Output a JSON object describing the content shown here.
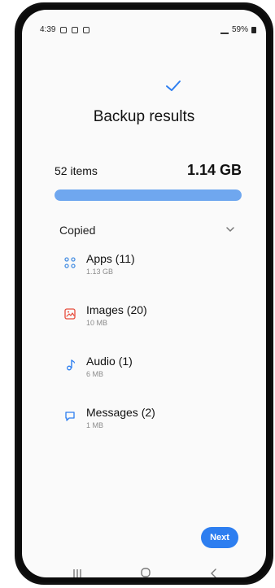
{
  "status_bar": {
    "time": "4:39",
    "right_text": "59%"
  },
  "header": {
    "title": "Backup results"
  },
  "summary": {
    "items_label": "52 items",
    "size_label": "1.14 GB",
    "progress_percent": 100
  },
  "section": {
    "label": "Copied"
  },
  "list": [
    {
      "title": "Apps (11)",
      "subtitle": "1.13 GB",
      "icon": "apps-icon"
    },
    {
      "title": "Images (20)",
      "subtitle": "10 MB",
      "icon": "image-icon"
    },
    {
      "title": "Audio (1)",
      "subtitle": "6 MB",
      "icon": "audio-icon"
    },
    {
      "title": "Messages (2)",
      "subtitle": "1 MB",
      "icon": "message-icon"
    }
  ],
  "buttons": {
    "next": "Next"
  },
  "colors": {
    "accent": "#2d7ef0",
    "progress": "#6fa7ef",
    "apps_icon": "#4a90e2",
    "image_icon": "#e74c3c",
    "audio_icon": "#2d7ef0",
    "message_icon": "#2d7ef0"
  }
}
